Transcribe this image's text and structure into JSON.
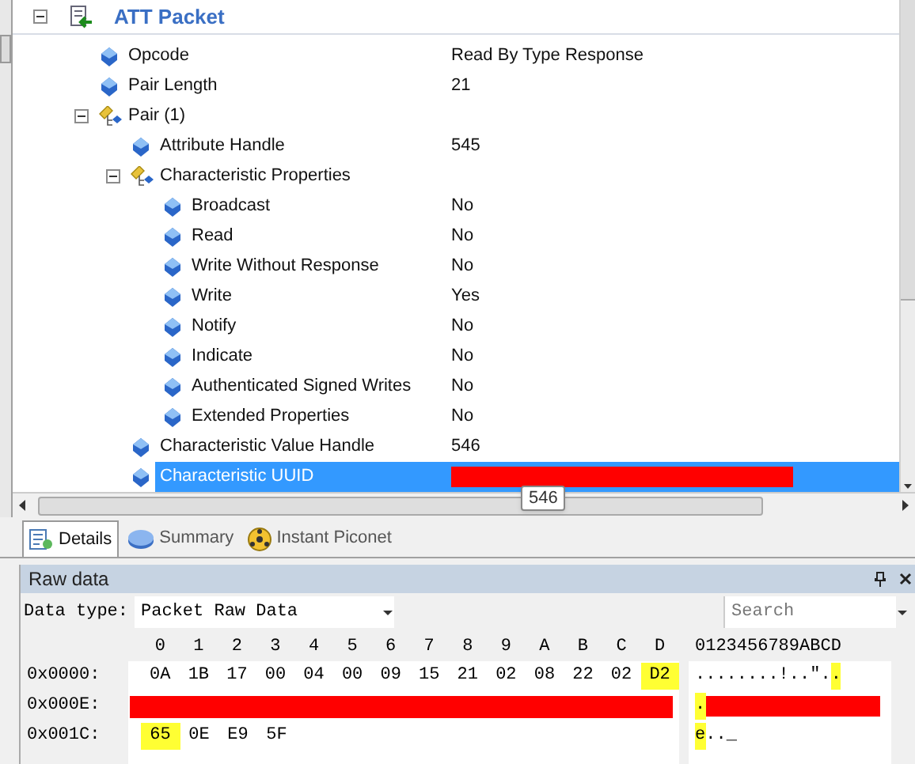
{
  "tree": {
    "header": {
      "title": "ATT Packet",
      "expanded": true
    },
    "items": [
      {
        "label": "Opcode",
        "value": "Read By Type Response",
        "selected": false
      },
      {
        "label": "Pair Length",
        "value": "21",
        "selected": false
      },
      {
        "label": "Pair (1)",
        "kind": "group",
        "expanded": true,
        "selected": false,
        "children": [
          {
            "label": "Attribute Handle",
            "value": "545",
            "selected": false
          },
          {
            "label": "Characteristic Properties",
            "kind": "group",
            "expanded": true,
            "selected": false,
            "children": [
              {
                "label": "Broadcast",
                "value": "No",
                "selected": false
              },
              {
                "label": "Read",
                "value": "No",
                "selected": false
              },
              {
                "label": "Write Without Response",
                "value": "No",
                "selected": false
              },
              {
                "label": "Write",
                "value": "Yes",
                "selected": false
              },
              {
                "label": "Notify",
                "value": "No",
                "selected": false
              },
              {
                "label": "Indicate",
                "value": "No",
                "selected": false
              },
              {
                "label": "Authenticated Signed Writes",
                "value": "No",
                "selected": false
              },
              {
                "label": "Extended Properties",
                "value": "No",
                "selected": false
              }
            ]
          },
          {
            "label": "Characteristic Value Handle",
            "value": "546",
            "selected": false
          },
          {
            "label": "Characteristic UUID",
            "redacted": true,
            "selected": true
          }
        ]
      }
    ]
  },
  "tooltip": "546",
  "tabs": [
    {
      "label": "Details",
      "selected": true
    },
    {
      "label": "Summary",
      "selected": false
    },
    {
      "label": "Instant Piconet",
      "selected": false
    }
  ],
  "raw_data": {
    "title": "Raw data",
    "data_type_label": "Data type:",
    "data_type": "Packet Raw Data",
    "search": {
      "placeholder": "Search"
    },
    "columns": [
      "0",
      "1",
      "2",
      "3",
      "4",
      "5",
      "6",
      "7",
      "8",
      "9",
      "A",
      "B",
      "C",
      "D"
    ],
    "ascii_header": "0123456789ABCD",
    "rows": [
      {
        "offset": "0x0000:",
        "bytes": [
          {
            "text": "0A",
            "highlighted": false
          },
          {
            "text": "1B",
            "highlighted": false
          },
          {
            "text": "17",
            "highlighted": false
          },
          {
            "text": "00",
            "highlighted": false
          },
          {
            "text": "04",
            "highlighted": false
          },
          {
            "text": "00",
            "highlighted": false
          },
          {
            "text": "09",
            "highlighted": false
          },
          {
            "text": "15",
            "highlighted": false
          },
          {
            "text": "21",
            "highlighted": false
          },
          {
            "text": "02",
            "highlighted": false
          },
          {
            "text": "08",
            "highlighted": false
          },
          {
            "text": "22",
            "highlighted": false
          },
          {
            "text": "02",
            "highlighted": false
          },
          {
            "text": "D2",
            "highlighted": true
          }
        ],
        "ascii": [
          {
            "text": "........!..\".",
            "highlighted": false
          },
          {
            "text": ".",
            "highlighted": true
          }
        ]
      },
      {
        "offset": "0x000E:",
        "redacted": true,
        "ascii": [
          {
            "text": ".",
            "highlighted": true
          }
        ]
      },
      {
        "offset": "0x001C:",
        "bytes": [
          {
            "text": "65",
            "highlighted": true
          },
          {
            "text": "0E",
            "highlighted": false
          },
          {
            "text": "E9",
            "highlighted": false
          },
          {
            "text": "5F",
            "highlighted": false
          }
        ],
        "ascii": [
          {
            "text": "e",
            "highlighted": true
          },
          {
            "text": "..",
            "highlighted": false
          },
          {
            "text": "_",
            "highlighted": false
          }
        ]
      }
    ]
  }
}
